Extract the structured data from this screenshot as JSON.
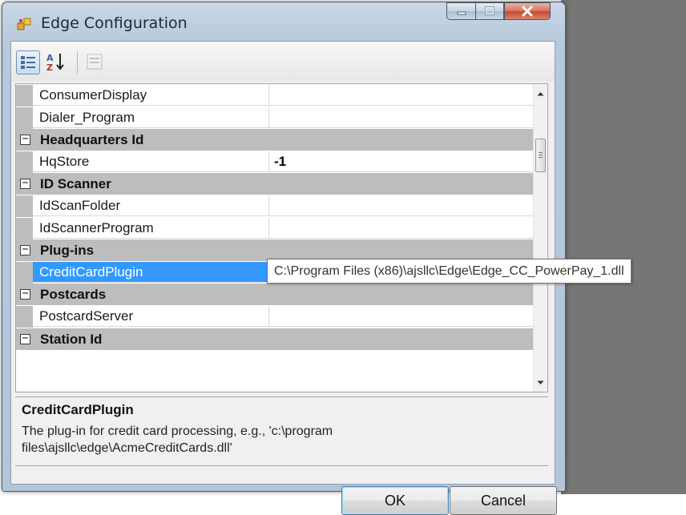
{
  "window": {
    "title": "Edge Configuration"
  },
  "toolbar": {
    "categorized_icon": "categorized-view-icon",
    "alphabetical_icon": "sort-alphabetical-icon",
    "property_pages_icon": "property-pages-icon"
  },
  "grid": {
    "rows": [
      {
        "type": "property",
        "name": "ConsumerDisplay",
        "value": ""
      },
      {
        "type": "property",
        "name": "Dialer_Program",
        "value": ""
      },
      {
        "type": "category",
        "name": "Headquarters Id"
      },
      {
        "type": "property",
        "name": "HqStore",
        "value": "-1"
      },
      {
        "type": "category",
        "name": "ID Scanner"
      },
      {
        "type": "property",
        "name": "IdScanFolder",
        "value": ""
      },
      {
        "type": "property",
        "name": "IdScannerProgram",
        "value": ""
      },
      {
        "type": "category",
        "name": "Plug-ins"
      },
      {
        "type": "property",
        "name": "CreditCardPlugin",
        "value": "",
        "selected": true
      },
      {
        "type": "category",
        "name": "Postcards"
      },
      {
        "type": "property",
        "name": "PostcardServer",
        "value": ""
      },
      {
        "type": "category",
        "name": "Station Id"
      }
    ],
    "expander_symbol": "⊟",
    "tooltip": "C:\\Program Files (x86)\\ajsllc\\Edge\\Edge_CC_PowerPay_1.dll"
  },
  "help": {
    "title": "CreditCardPlugin",
    "description": "The plug-in for credit card processing, e.g., 'c:\\program files\\ajsllc\\edge\\AcmeCreditCards.dll'"
  },
  "buttons": {
    "ok": "OK",
    "cancel": "Cancel"
  },
  "colors": {
    "selection": "#3399ff",
    "category_background": "#bdbdbd",
    "close_button": "#c34a2f"
  }
}
